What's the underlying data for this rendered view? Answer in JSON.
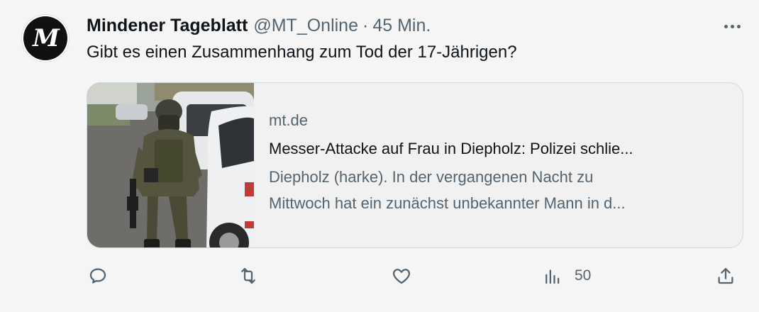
{
  "tweet": {
    "author_name": "Mindener Tageblatt",
    "author_handle": "@MT_Online",
    "separator": "·",
    "time": "45 Min.",
    "avatar_letter": "M",
    "text": "Gibt es einen Zusammenhang zum Tod der 17-Jährigen?"
  },
  "card": {
    "domain": "mt.de",
    "headline": "Messer-Attacke auf Frau in Diepholz: Polizei schlie...",
    "description_line1": "Diepholz (harke). In der vergangenen Nacht zu",
    "description_line2": "Mittwoch hat ein zunächst unbekannter Mann in d..."
  },
  "actions": {
    "views_count": "50"
  },
  "icons": [
    "more-icon",
    "reply-icon",
    "retweet-icon",
    "like-icon",
    "views-icon",
    "share-icon"
  ]
}
